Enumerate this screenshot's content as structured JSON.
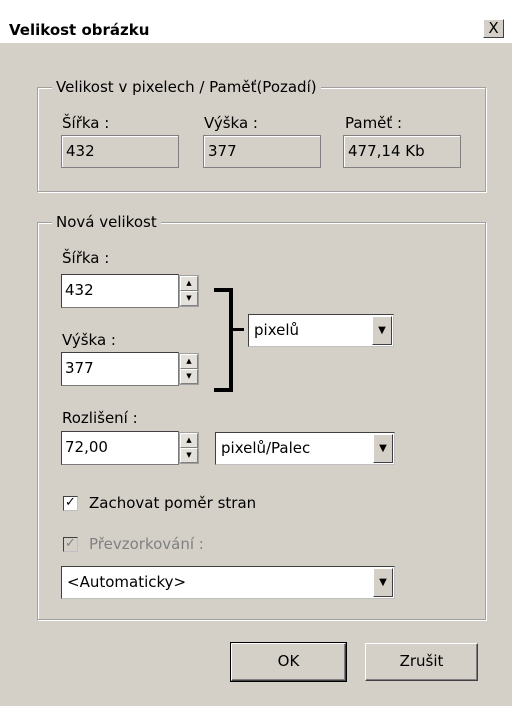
{
  "title": "Velikost obrázku",
  "close_symbol": "X",
  "current": {
    "legend": "Velikost v pixelech / Paměť(Pozadí)",
    "width_label": "Šířka :",
    "width_value": "432",
    "height_label": "Výška :",
    "height_value": "377",
    "memory_label": "Paměť :",
    "memory_value": "477,14 Kb"
  },
  "new_size": {
    "legend": "Nová velikost",
    "width_label": "Šířka :",
    "width_value": "432",
    "height_label": "Výška :",
    "height_value": "377",
    "unit": "pixelů",
    "resolution_label": "Rozlišení :",
    "resolution_value": "72,00",
    "resolution_unit": "pixelů/Palec",
    "keep_ratio_label": "Zachovat poměr stran",
    "keep_ratio_checked": true,
    "resample_label": "Převzorkování :",
    "resample_checked": true,
    "resample_enabled": false,
    "resample_method": "<Automaticky>"
  },
  "buttons": {
    "ok": "OK",
    "cancel": "Zrušit"
  },
  "icons": {
    "spin_up": "up-arrow-icon",
    "spin_down": "down-arrow-icon",
    "dropdown": "chevron-down-icon",
    "check": "check-icon",
    "close": "close-icon"
  }
}
